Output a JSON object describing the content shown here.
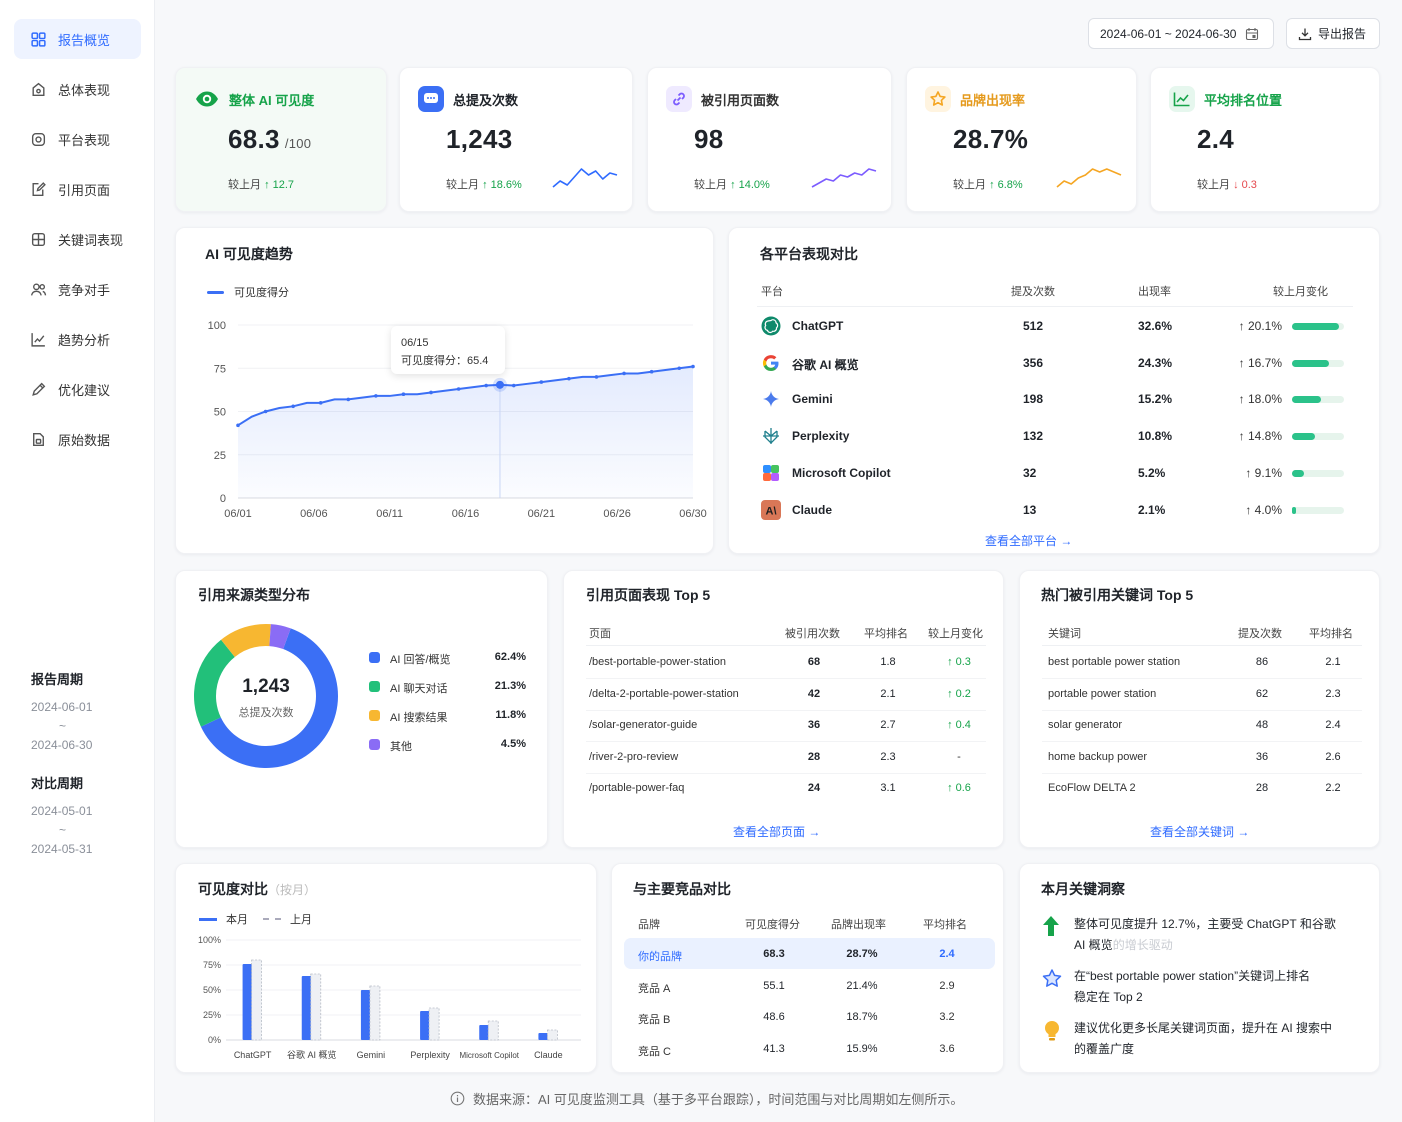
{
  "nav": {
    "items": [
      {
        "label": "报告概览"
      },
      {
        "label": "总体表现"
      },
      {
        "label": "平台表现"
      },
      {
        "label": "引用页面"
      },
      {
        "label": "关键词表现"
      },
      {
        "label": "竞争对手"
      },
      {
        "label": "趋势分析"
      },
      {
        "label": "优化建议"
      },
      {
        "label": "原始数据"
      }
    ]
  },
  "period": {
    "title": "报告周期",
    "start": "2024-06-01",
    "sep": "~",
    "end": "2024-06-30"
  },
  "compare": {
    "title": "对比周期",
    "start": "2024-05-01",
    "sep": "~",
    "end": "2024-05-31"
  },
  "header": {
    "date_range": "2024-06-01 ~ 2024-06-30",
    "export_label": "导出报告"
  },
  "kpis": [
    {
      "title": "整体 AI 可见度",
      "value": "68.3",
      "suffix": "/100",
      "cmp_label": "较上月",
      "delta": "↑ 12.7",
      "color": "#16a34a"
    },
    {
      "title": "总提及次数",
      "value": "1,243",
      "suffix": "",
      "cmp_label": "较上月",
      "delta": "↑ 18.6%",
      "color": "#2f6bff",
      "spark": [
        9,
        12,
        10,
        14,
        18,
        15,
        17,
        13,
        16,
        15
      ]
    },
    {
      "title": "被引用页面数",
      "value": "98",
      "suffix": "",
      "cmp_label": "较上月",
      "delta": "↑ 14.0%",
      "color": "#7c5cff",
      "spark": [
        8,
        10,
        12,
        11,
        14,
        13,
        15,
        14,
        17,
        16
      ]
    },
    {
      "title": "品牌出现率",
      "value": "28.7%",
      "suffix": "",
      "cmp_label": "较上月",
      "delta": "↑ 6.8%",
      "color": "#f5a623",
      "spark": [
        6,
        8,
        7,
        9,
        10,
        12,
        11,
        12,
        11,
        10
      ]
    },
    {
      "title": "平均排名位置",
      "value": "2.4",
      "suffix": "",
      "cmp_label": "较上月",
      "delta": "↓ 0.3",
      "color": "#16a34a"
    }
  ],
  "trend": {
    "title": "AI 可见度趋势",
    "legend": "可见度得分",
    "tooltip_date": "06/15",
    "tooltip_text": "可见度得分：65.4",
    "chart_data": {
      "type": "area",
      "title": "AI 可见度趋势",
      "series": [
        {
          "name": "可见度得分",
          "values": [
            42,
            47,
            50,
            52,
            53,
            55,
            55,
            57,
            57,
            58,
            59,
            59,
            60,
            60,
            61,
            62,
            63,
            64,
            65,
            65.4,
            65,
            66,
            67,
            68,
            69,
            70,
            70,
            71,
            72,
            72,
            73,
            74,
            75,
            76
          ]
        }
      ],
      "x_ticks": [
        "06/01",
        "06/06",
        "06/11",
        "06/16",
        "06/21",
        "06/26",
        "06/30"
      ],
      "y_ticks": [
        "0",
        "25",
        "50",
        "75",
        "100"
      ],
      "ylim": [
        0,
        100
      ]
    }
  },
  "platforms": {
    "title": "各平台表现对比",
    "headers": [
      "平台",
      "提及次数",
      "出现率",
      "较上月变化"
    ],
    "rows": [
      {
        "name": "ChatGPT",
        "mentions": "512",
        "rate": "32.6%",
        "change": "↑ 20.1%",
        "bar": 0.9
      },
      {
        "name": "谷歌 AI 概览",
        "mentions": "356",
        "rate": "24.3%",
        "change": "↑ 16.7%",
        "bar": 0.72
      },
      {
        "name": "Gemini",
        "mentions": "198",
        "rate": "15.2%",
        "change": "↑ 18.0%",
        "bar": 0.56
      },
      {
        "name": "Perplexity",
        "mentions": "132",
        "rate": "10.8%",
        "change": "↑ 14.8%",
        "bar": 0.44
      },
      {
        "name": "Microsoft Copilot",
        "mentions": "32",
        "rate": "5.2%",
        "change": "↑ 9.1%",
        "bar": 0.24
      },
      {
        "name": "Claude",
        "mentions": "13",
        "rate": "2.1%",
        "change": "↑ 4.0%",
        "bar": 0.08
      }
    ],
    "link": "查看全部平台 →"
  },
  "sources": {
    "title": "引用来源类型分布",
    "center_value": "1,243",
    "center_label": "总提及次数",
    "chart_data": {
      "type": "pie",
      "categories": [
        "AI 回答/概览",
        "AI 聊天对话",
        "AI 搜索结果",
        "其他"
      ],
      "values": [
        62.4,
        21.3,
        11.8,
        4.5
      ],
      "labels": [
        "62.4%",
        "21.3%",
        "11.8%",
        "4.5%"
      ],
      "colors": [
        "#3b6ff5",
        "#22c07a",
        "#f7b731",
        "#8a6cf5"
      ]
    }
  },
  "pages": {
    "title": "引用页面表现 Top 5",
    "headers": [
      "页面",
      "被引用次数",
      "平均排名",
      "较上月变化"
    ],
    "rows": [
      {
        "page": "/best-portable-power-station",
        "count": "68",
        "rank": "1.8",
        "change": "↑ 0.3"
      },
      {
        "page": "/delta-2-portable-power-station",
        "count": "42",
        "rank": "2.1",
        "change": "↑ 0.2"
      },
      {
        "page": "/solar-generator-guide",
        "count": "36",
        "rank": "2.7",
        "change": "↑ 0.4"
      },
      {
        "page": "/river-2-pro-review",
        "count": "28",
        "rank": "2.3",
        "change": "-"
      },
      {
        "page": "/portable-power-faq",
        "count": "24",
        "rank": "3.1",
        "change": "↑ 0.6"
      }
    ],
    "link": "查看全部页面 →"
  },
  "keywords": {
    "title": "热门被引用关键词 Top 5",
    "headers": [
      "关键词",
      "提及次数",
      "平均排名"
    ],
    "rows": [
      {
        "kw": "best portable power station",
        "count": "86",
        "rank": "2.1"
      },
      {
        "kw": "portable power station",
        "count": "62",
        "rank": "2.3"
      },
      {
        "kw": "solar generator",
        "count": "48",
        "rank": "2.4"
      },
      {
        "kw": "home backup power",
        "count": "36",
        "rank": "2.6"
      },
      {
        "kw": "EcoFlow DELTA 2",
        "count": "28",
        "rank": "2.2"
      }
    ],
    "link": "查看全部关键词 →"
  },
  "visibility": {
    "title": "可见度对比",
    "subtitle": "（按月）",
    "legend_current": "本月",
    "legend_prev": "上月",
    "chart_data": {
      "type": "bar",
      "categories": [
        "ChatGPT",
        "谷歌 AI 概览",
        "Gemini",
        "Perplexity",
        "Microsoft Copilot",
        "Claude"
      ],
      "series": [
        {
          "name": "本月",
          "values": [
            76,
            64,
            50,
            29,
            15,
            7
          ]
        },
        {
          "name": "上月",
          "values": [
            80,
            66,
            54,
            32,
            19,
            10
          ]
        }
      ],
      "y_ticks": [
        "100%",
        "75%",
        "50%",
        "25%",
        "0%"
      ],
      "ylim": [
        0,
        100
      ]
    }
  },
  "competitors": {
    "title": "与主要竞品对比",
    "headers": [
      "品牌",
      "可见度得分",
      "品牌出现率",
      "平均排名"
    ],
    "rows": [
      {
        "brand": "你的品牌",
        "score": "68.3",
        "rate": "28.7%",
        "rank": "2.4"
      },
      {
        "brand": "竞品 A",
        "score": "55.1",
        "rate": "21.4%",
        "rank": "2.9"
      },
      {
        "brand": "竞品 B",
        "score": "48.6",
        "rate": "18.7%",
        "rank": "3.2"
      },
      {
        "brand": "竞品 C",
        "score": "41.3",
        "rate": "15.9%",
        "rank": "3.6"
      }
    ]
  },
  "insights": {
    "title": "本月关键洞察",
    "items": [
      {
        "line1": "整体可见度提升 12.7%，主要受 ChatGPT 和谷歌",
        "line2": "AI 概览",
        "line2_faint": "的增长驱动"
      },
      {
        "line1": "在“best portable power station”关键词上排名",
        "line2": "稳定在 Top 2",
        "line2_faint": ""
      },
      {
        "line1": "建议优化更多长尾关键词页面，提升在 AI 搜索中",
        "line2": "的覆盖广度",
        "line2_faint": ""
      }
    ]
  },
  "footer": {
    "text": "数据来源：AI 可见度监测工具（基于多平台跟踪），时间范围与对比周期如左侧所示。"
  }
}
